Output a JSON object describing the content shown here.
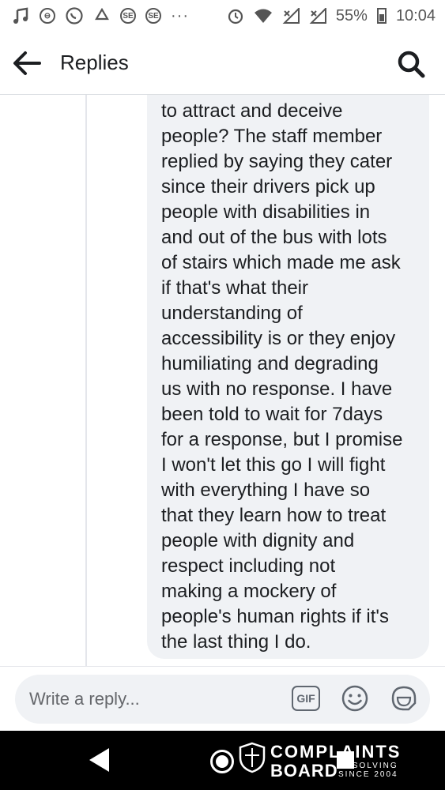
{
  "status_bar": {
    "icons": [
      "music-note-icon",
      "blocked-call-icon",
      "whatsapp-icon",
      "recycle-icon",
      "se-icon",
      "se-icon",
      "more-dots-icon",
      "alarm-icon",
      "wifi-icon",
      "signal-icon",
      "signal-icon"
    ],
    "se_label": "SE",
    "dots": "···",
    "battery": "55%",
    "time": "10:04"
  },
  "header": {
    "title": "Replies",
    "back_icon": "arrow-left-icon",
    "search_icon": "search-icon"
  },
  "reply": {
    "text": "to attract and deceive\npeople? The staff member\nreplied by saying they cater\nsince their drivers pick up\npeople with disabilities in\nand out of the bus with lots\nof stairs which made me ask\nif that's what their\nunderstanding of\naccessibility is or they enjoy\nhumiliating and degrading\nus with no response. I have\nbeen told to wait for 7days\nfor a response, but I promise\nI won't let this go I will fight\nwith everything I have so\nthat they learn how to treat\npeople with dignity and\nrespect including not\nmaking a mockery of\npeople's human rights if it's\nthe last thing I do."
  },
  "composer": {
    "placeholder": "Write a reply...",
    "gif_label": "GIF",
    "emoji_icon": "smiley-icon",
    "sticker_icon": "sticker-icon"
  },
  "watermark": {
    "line1": "COMPLAINTS",
    "line2": "BOARD",
    "line3": "RESOLVING\nSINCE 2004"
  },
  "colors": {
    "bubble": "#f0f2f5",
    "text": "#1c1e21",
    "placeholder": "#65676b",
    "nav_bar": "#000000"
  }
}
